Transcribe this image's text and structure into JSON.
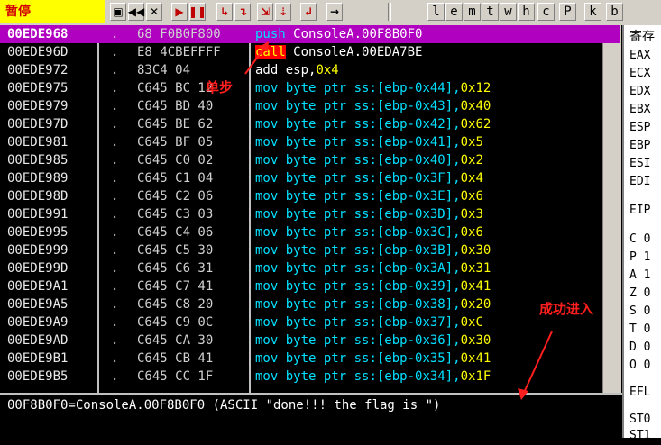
{
  "status": "暂停",
  "toolbar_letters": [
    "l",
    "e",
    "m",
    "t",
    "w",
    "h",
    "c",
    "P",
    "k",
    "b"
  ],
  "rows": [
    {
      "addr": "00EDE968",
      "dot": ".",
      "hex": "68 F0B0F800",
      "mn": "push",
      "ops": "ConsoleA.00F8B0F0",
      "sel": true
    },
    {
      "addr": "00EDE96D",
      "dot": ".",
      "hex": "E8 4CBEFFFF",
      "mn": "call",
      "ops": "ConsoleA.00EDA7BE"
    },
    {
      "addr": "00EDE972",
      "dot": ".",
      "hex": "83C4 04",
      "mn": "add",
      "ops": "esp,0x4"
    },
    {
      "addr": "00EDE975",
      "dot": ".",
      "hex": "C645 BC 12",
      "mn": "mov",
      "ops": "byte ptr ss:[ebp-0x44],0x12"
    },
    {
      "addr": "00EDE979",
      "dot": ".",
      "hex": "C645 BD 40",
      "mn": "mov",
      "ops": "byte ptr ss:[ebp-0x43],0x40"
    },
    {
      "addr": "00EDE97D",
      "dot": ".",
      "hex": "C645 BE 62",
      "mn": "mov",
      "ops": "byte ptr ss:[ebp-0x42],0x62"
    },
    {
      "addr": "00EDE981",
      "dot": ".",
      "hex": "C645 BF 05",
      "mn": "mov",
      "ops": "byte ptr ss:[ebp-0x41],0x5"
    },
    {
      "addr": "00EDE985",
      "dot": ".",
      "hex": "C645 C0 02",
      "mn": "mov",
      "ops": "byte ptr ss:[ebp-0x40],0x2"
    },
    {
      "addr": "00EDE989",
      "dot": ".",
      "hex": "C645 C1 04",
      "mn": "mov",
      "ops": "byte ptr ss:[ebp-0x3F],0x4"
    },
    {
      "addr": "00EDE98D",
      "dot": ".",
      "hex": "C645 C2 06",
      "mn": "mov",
      "ops": "byte ptr ss:[ebp-0x3E],0x6"
    },
    {
      "addr": "00EDE991",
      "dot": ".",
      "hex": "C645 C3 03",
      "mn": "mov",
      "ops": "byte ptr ss:[ebp-0x3D],0x3"
    },
    {
      "addr": "00EDE995",
      "dot": ".",
      "hex": "C645 C4 06",
      "mn": "mov",
      "ops": "byte ptr ss:[ebp-0x3C],0x6"
    },
    {
      "addr": "00EDE999",
      "dot": ".",
      "hex": "C645 C5 30",
      "mn": "mov",
      "ops": "byte ptr ss:[ebp-0x3B],0x30"
    },
    {
      "addr": "00EDE99D",
      "dot": ".",
      "hex": "C645 C6 31",
      "mn": "mov",
      "ops": "byte ptr ss:[ebp-0x3A],0x31"
    },
    {
      "addr": "00EDE9A1",
      "dot": ".",
      "hex": "C645 C7 41",
      "mn": "mov",
      "ops": "byte ptr ss:[ebp-0x39],0x41"
    },
    {
      "addr": "00EDE9A5",
      "dot": ".",
      "hex": "C645 C8 20",
      "mn": "mov",
      "ops": "byte ptr ss:[ebp-0x38],0x20"
    },
    {
      "addr": "00EDE9A9",
      "dot": ".",
      "hex": "C645 C9 0C",
      "mn": "mov",
      "ops": "byte ptr ss:[ebp-0x37],0xC"
    },
    {
      "addr": "00EDE9AD",
      "dot": ".",
      "hex": "C645 CA 30",
      "mn": "mov",
      "ops": "byte ptr ss:[ebp-0x36],0x30"
    },
    {
      "addr": "00EDE9B1",
      "dot": ".",
      "hex": "C645 CB 41",
      "mn": "mov",
      "ops": "byte ptr ss:[ebp-0x35],0x41"
    },
    {
      "addr": "00EDE9B5",
      "dot": ".",
      "hex": "C645 CC 1F",
      "mn": "mov",
      "ops": "byte ptr ss:[ebp-0x34],0x1F"
    }
  ],
  "info_line": "00F8B0F0=ConsoleA.00F8B0F0 (ASCII \"done!!! the flag is \")",
  "registers": {
    "title": "寄存",
    "names": [
      "EAX",
      "ECX",
      "EDX",
      "EBX",
      "ESP",
      "EBP",
      "ESI",
      "EDI"
    ],
    "eip": "EIP",
    "flags": [
      "C 0",
      "P 1",
      "A 1",
      "Z 0",
      "S 0",
      "T 0",
      "D 0",
      "O 0"
    ],
    "efl": "EFL",
    "st": [
      "ST0",
      "ST1"
    ]
  },
  "annotations": {
    "step": "单步",
    "success": "成功进入"
  },
  "colors": {
    "selected_row": "#b000c0",
    "mnemonic": "#00e0ff",
    "immediate": "#ffff00",
    "status_bg": "#ffff00"
  }
}
